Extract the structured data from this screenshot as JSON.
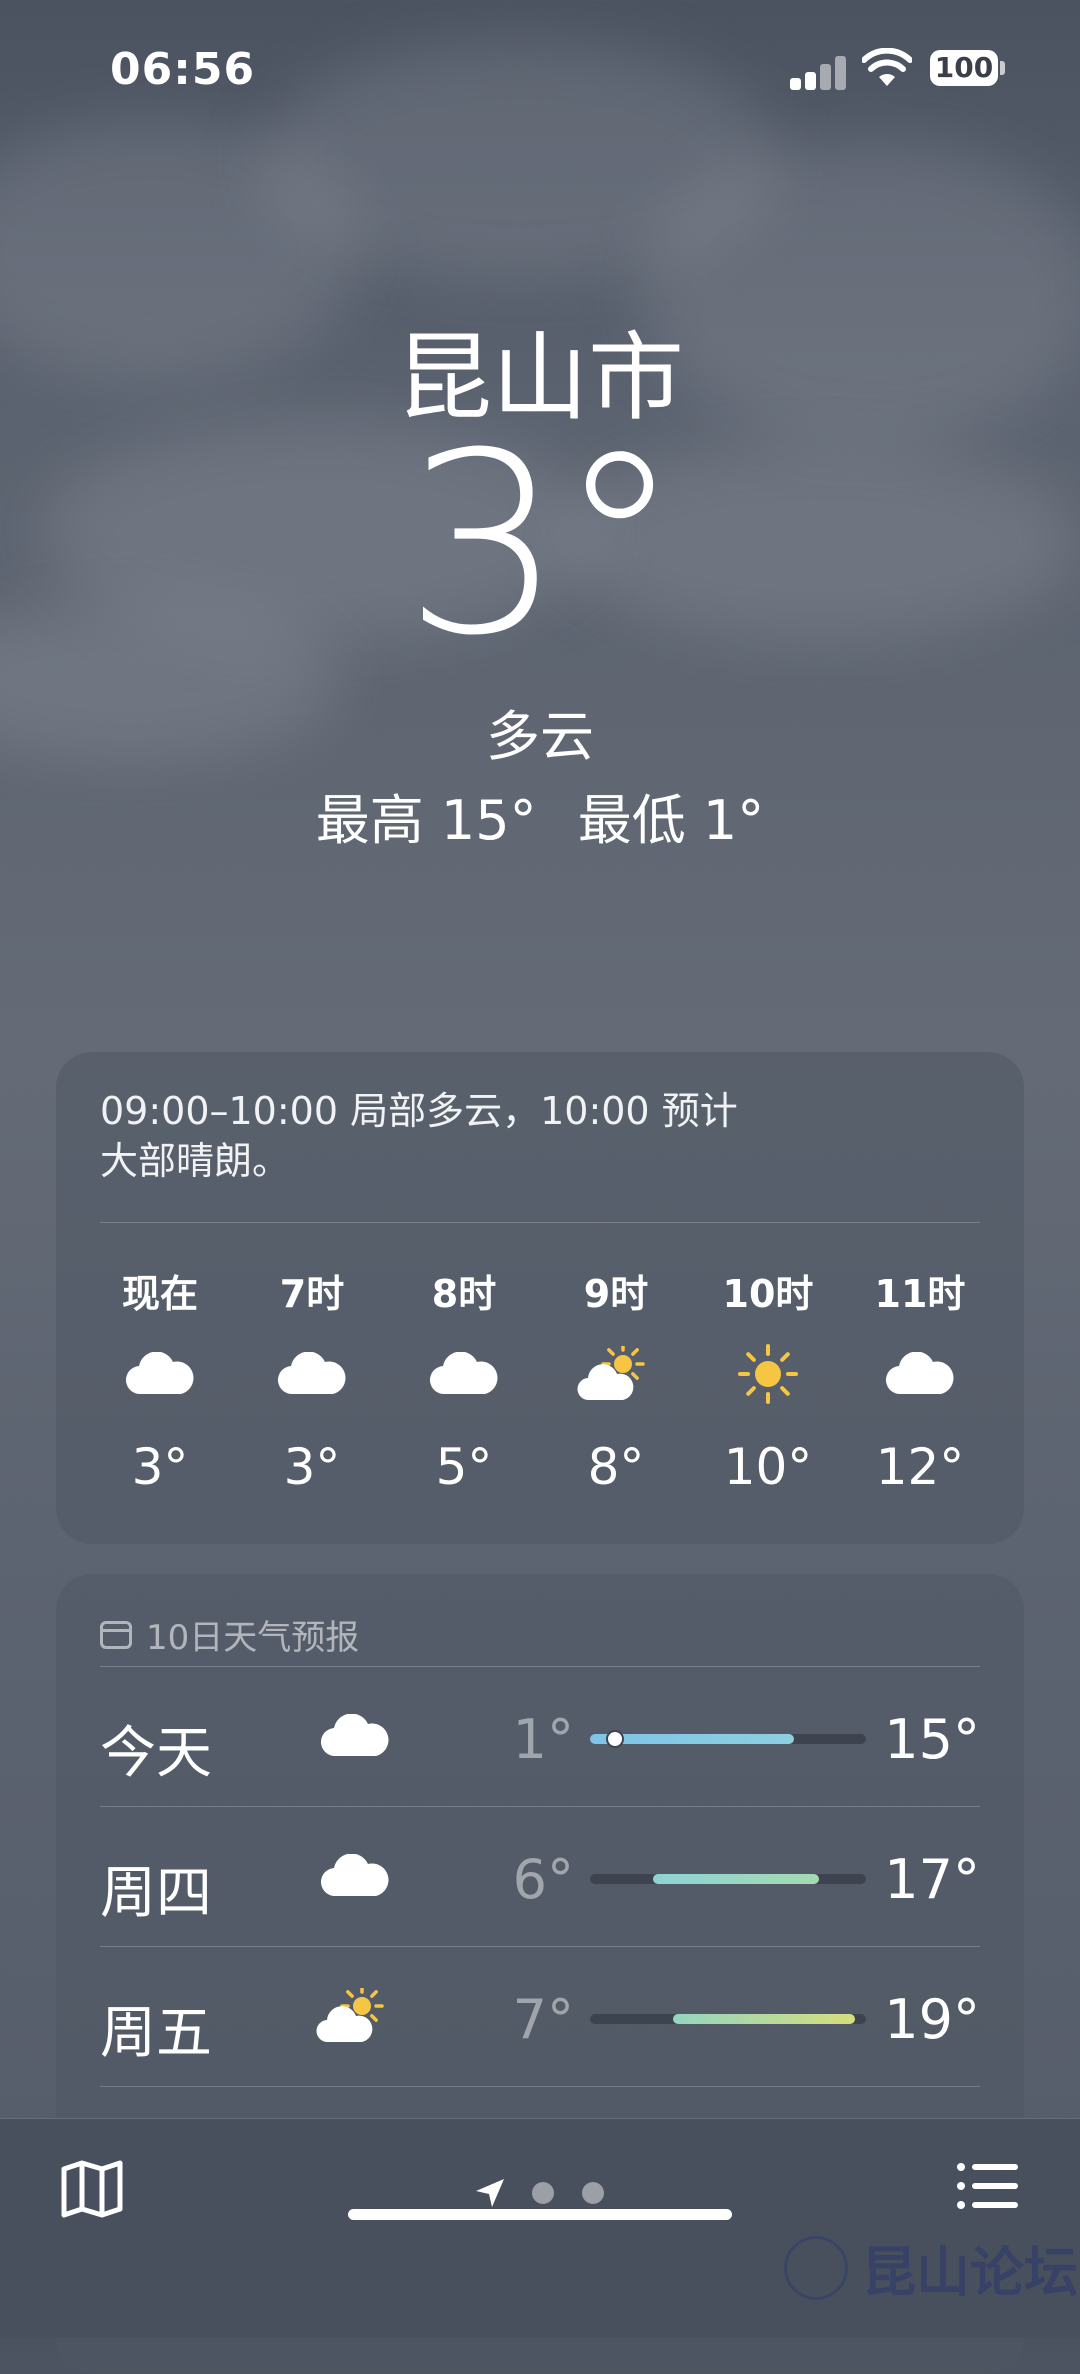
{
  "status_bar": {
    "time": "06:56",
    "battery": "100"
  },
  "location": {
    "city": "昆山市",
    "temperature": "3°",
    "condition": "多云",
    "high": "最高 15°",
    "low": "最低 1°"
  },
  "hourly_card": {
    "summary_line1": "09:00–10:00 局部多云，10:00 预计",
    "summary_line2": "大部晴朗。",
    "hours": [
      {
        "label": "现在",
        "icon": "cloud-icon",
        "temp": "3°"
      },
      {
        "label": "7时",
        "icon": "cloud-icon",
        "temp": "3°"
      },
      {
        "label": "8时",
        "icon": "cloud-icon",
        "temp": "5°"
      },
      {
        "label": "9时",
        "icon": "partly-sunny-icon",
        "temp": "8°"
      },
      {
        "label": "10时",
        "icon": "sun-icon",
        "temp": "10°"
      },
      {
        "label": "11时",
        "icon": "cloud-icon",
        "temp": "12°"
      }
    ]
  },
  "daily_card": {
    "header": "10日天气预报",
    "days": [
      {
        "day": "今天",
        "icon": "cloud-icon",
        "low": "1°",
        "high": "15°",
        "range_start": 0.0,
        "range_end": 0.74,
        "current": 0.09,
        "colors": [
          "#7fc4e8",
          "#8ecfe0"
        ]
      },
      {
        "day": "周四",
        "icon": "cloud-icon",
        "low": "6°",
        "high": "17°",
        "range_start": 0.23,
        "range_end": 0.83,
        "colors": [
          "#8fd3d6",
          "#a3dbb0"
        ]
      },
      {
        "day": "周五",
        "icon": "partly-sunny-icon",
        "low": "7°",
        "high": "19°",
        "range_start": 0.3,
        "range_end": 0.96,
        "colors": [
          "#94d6bf",
          "#d6dd7e"
        ]
      }
    ]
  },
  "watermark": "昆山论坛"
}
